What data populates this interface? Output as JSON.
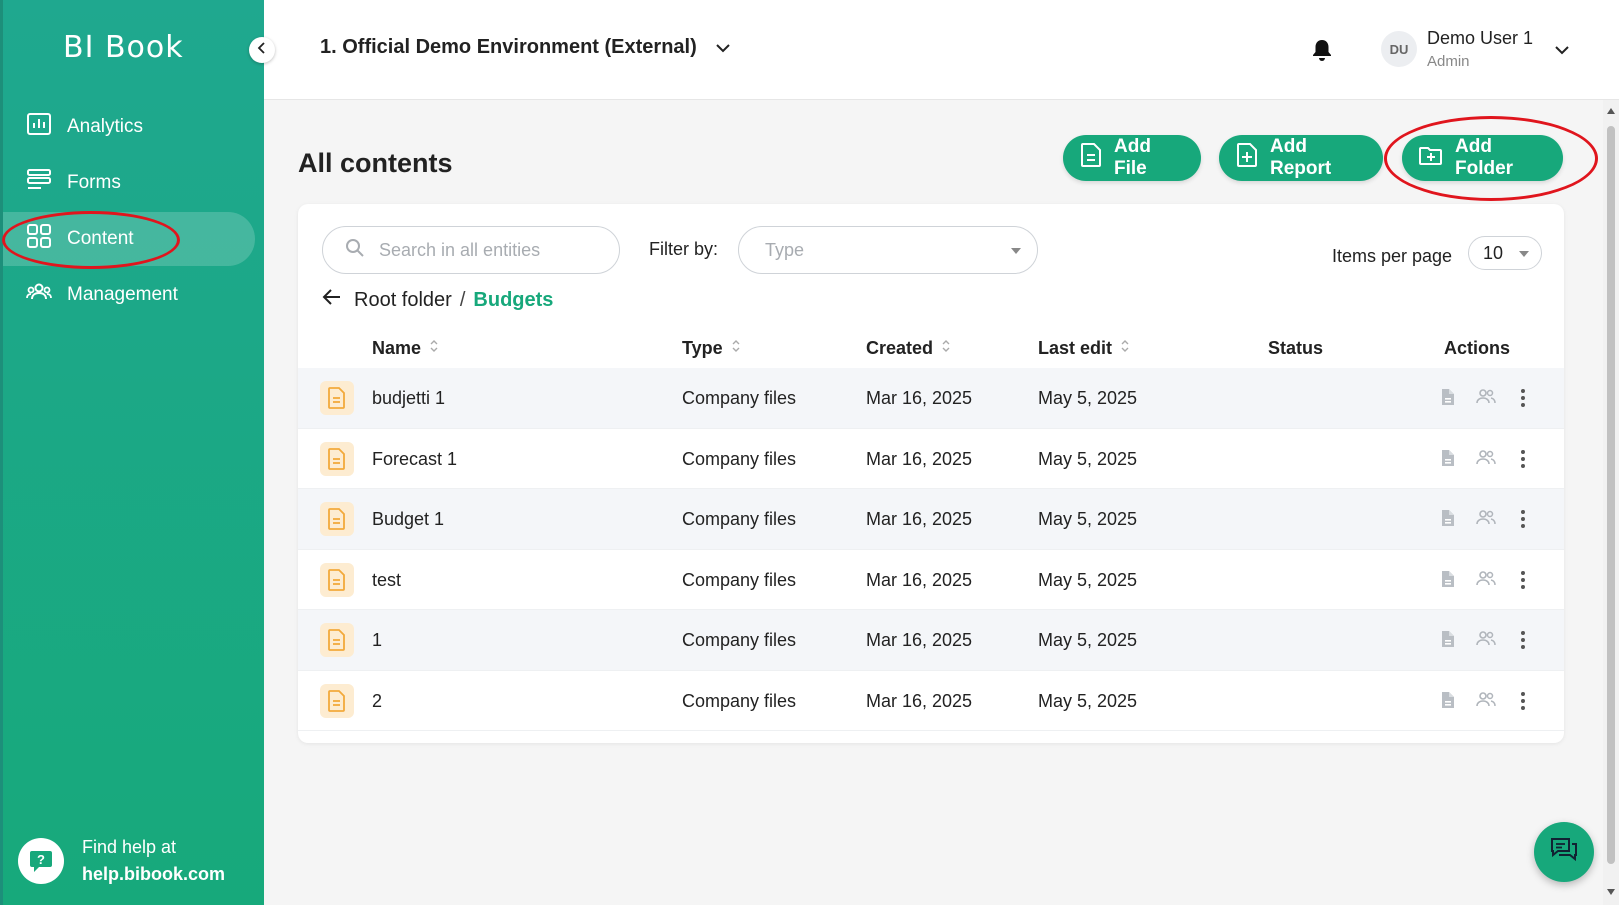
{
  "sidebar": {
    "logo": "BI Book",
    "items": [
      {
        "label": "Analytics",
        "icon": "analytics-icon"
      },
      {
        "label": "Forms",
        "icon": "forms-icon"
      },
      {
        "label": "Content",
        "icon": "content-grid-icon",
        "active": true
      },
      {
        "label": "Management",
        "icon": "people-icon"
      }
    ],
    "help": {
      "line1": "Find help at",
      "line2": "help.bibook.com"
    }
  },
  "header": {
    "environment": "1. Official Demo Environment (External)",
    "user": {
      "initials": "DU",
      "name": "Demo User 1",
      "role": "Admin"
    }
  },
  "main": {
    "title": "All contents",
    "buttons": {
      "add_file": "Add File",
      "add_report": "Add Report",
      "add_folder": "Add Folder"
    },
    "search": {
      "placeholder": "Search in all entities"
    },
    "filter": {
      "label": "Filter by:",
      "type_placeholder": "Type"
    },
    "items_per_page": {
      "label": "Items per page",
      "value": "10"
    },
    "breadcrumb": {
      "root": "Root folder",
      "separator": "/",
      "current": "Budgets"
    },
    "columns": {
      "name": "Name",
      "type": "Type",
      "created": "Created",
      "last_edit": "Last edit",
      "status": "Status",
      "actions": "Actions"
    },
    "rows": [
      {
        "name": "budjetti 1",
        "type": "Company files",
        "created": "Mar 16, 2025",
        "last_edit": "May 5, 2025",
        "status": ""
      },
      {
        "name": "Forecast 1",
        "type": "Company files",
        "created": "Mar 16, 2025",
        "last_edit": "May 5, 2025",
        "status": ""
      },
      {
        "name": "Budget 1",
        "type": "Company files",
        "created": "Mar 16, 2025",
        "last_edit": "May 5, 2025",
        "status": ""
      },
      {
        "name": "test",
        "type": "Company files",
        "created": "Mar 16, 2025",
        "last_edit": "May 5, 2025",
        "status": ""
      },
      {
        "name": "1",
        "type": "Company files",
        "created": "Mar 16, 2025",
        "last_edit": "May 5, 2025",
        "status": ""
      },
      {
        "name": "2",
        "type": "Company files",
        "created": "Mar 16, 2025",
        "last_edit": "May 5, 2025",
        "status": ""
      }
    ]
  },
  "colors": {
    "brand": "#17a87b",
    "annotation": "#e0151d",
    "file_icon": "#f2a93b"
  }
}
